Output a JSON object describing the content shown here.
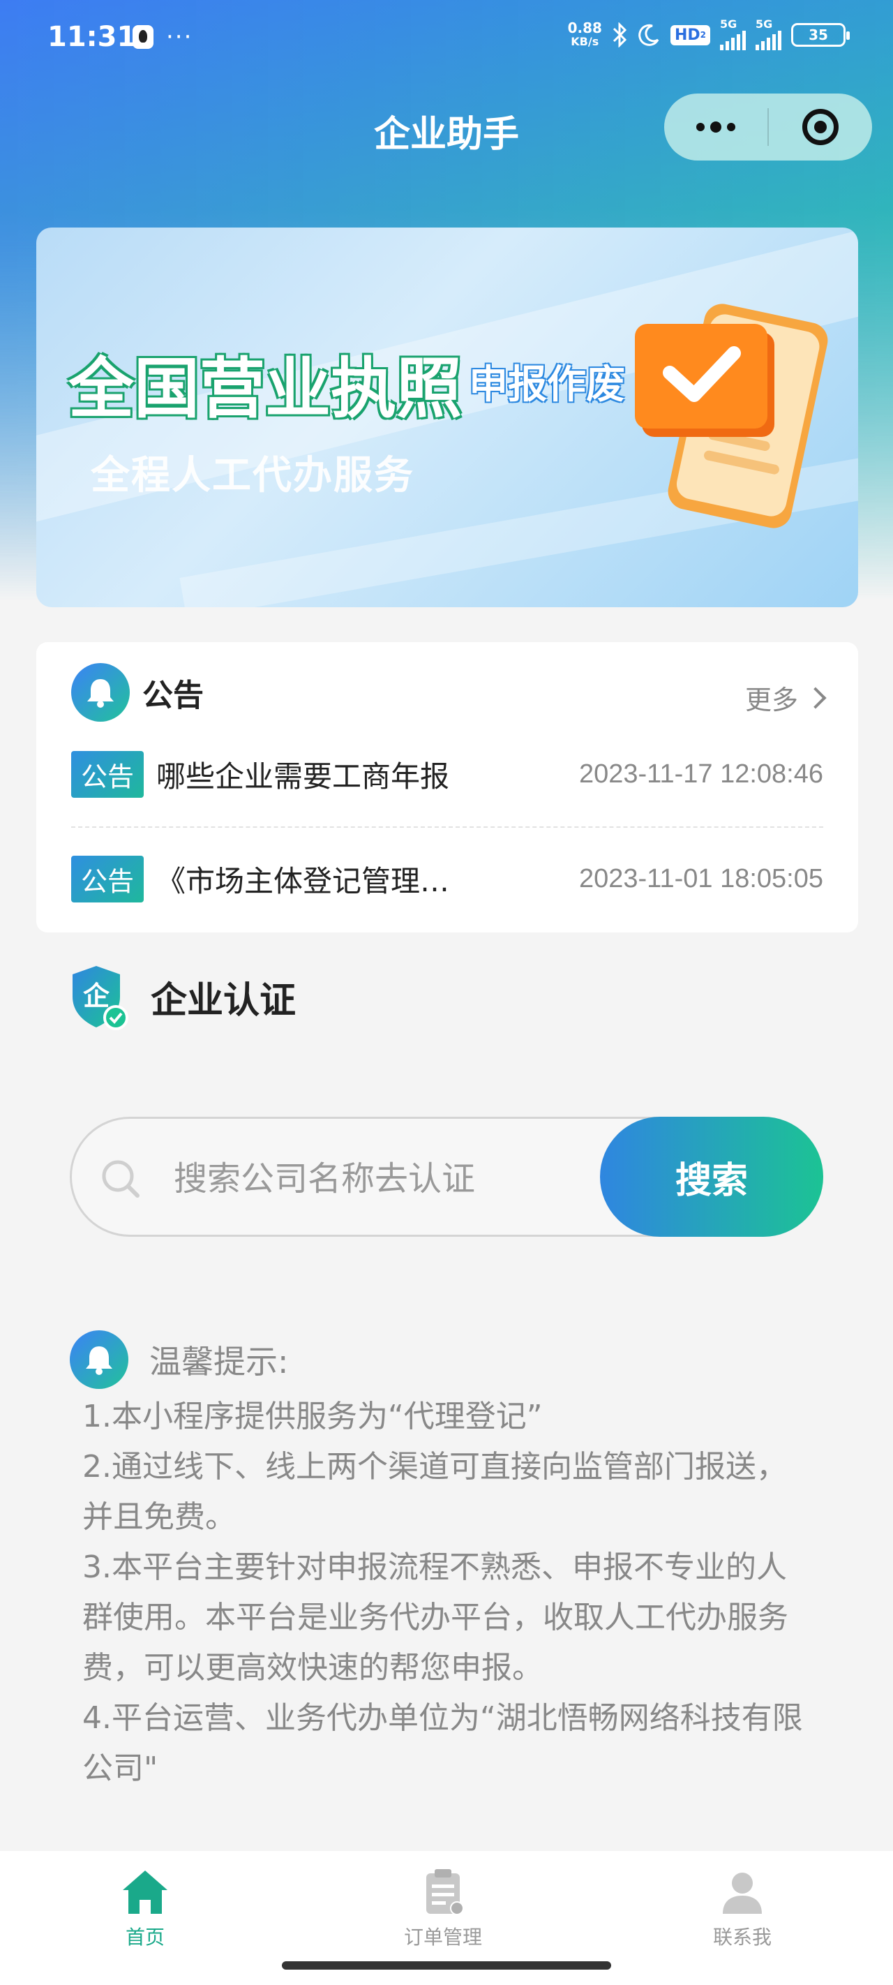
{
  "status_bar": {
    "time": "11:31",
    "dots": "···",
    "net_speed_value": "0.88",
    "net_speed_unit": "KB/s",
    "hd_label": "HD",
    "hd_sub": "2",
    "net1": "5G",
    "net2": "5G",
    "battery": "35"
  },
  "nav": {
    "title": "企业助手"
  },
  "banner": {
    "title": "全国营业执照",
    "tag": "申报作废",
    "subtitle": "全程人工代办服务"
  },
  "notice": {
    "title": "公告",
    "more_label": "更多",
    "items": [
      {
        "tag": "公告",
        "text": "哪些企业需要工商年报",
        "date": "2023-11-17 12:08:46"
      },
      {
        "tag": "公告",
        "text": "《市场主体登记管理…",
        "date": "2023-11-01 18:05:05"
      }
    ]
  },
  "cert": {
    "title": "企业认证",
    "icon_char": "企"
  },
  "search": {
    "placeholder": "搜索公司名称去认证",
    "button_label": "搜索"
  },
  "tips": {
    "title": "温馨提示:",
    "lines": [
      "1.本小程序提供服务为“代理登记”",
      "2.通过线下、线上两个渠道可直接向监管部门报送，并且免费。",
      "3.本平台主要针对申报流程不熟悉、申报不专业的人群使用。本平台是业务代办平台，收取人工代办服务费，可以更高效快速的帮您申报。",
      "4.平台运营、业务代办单位为“湖北悟畅网络科技有限公司\""
    ]
  },
  "tabbar": {
    "tabs": [
      {
        "label": "首页",
        "icon": "home-icon",
        "active": true
      },
      {
        "label": "订单管理",
        "icon": "clipboard-icon",
        "active": false
      },
      {
        "label": "联系我",
        "icon": "person-icon",
        "active": false
      }
    ]
  },
  "colors": {
    "accent_start": "#2f86e0",
    "accent_end": "#1cc394",
    "active_tab": "#1aa98a"
  }
}
